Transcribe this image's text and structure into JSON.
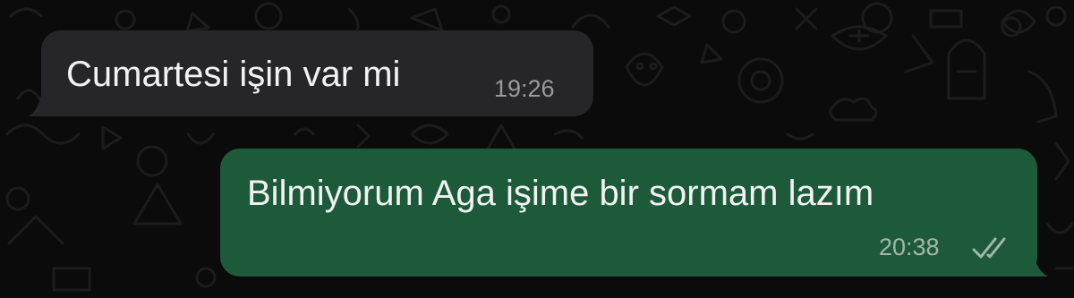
{
  "theme": {
    "background": "#0b0b0b",
    "incoming_bubble": "#262628",
    "outgoing_bubble": "#1d5a3a",
    "text": "#f2f2f2",
    "timestamp_incoming": "#9a9a9c",
    "timestamp_outgoing": "#a4b8aa"
  },
  "messages": [
    {
      "direction": "incoming",
      "text": "Cumartesi işin var mi",
      "time": "19:26"
    },
    {
      "direction": "outgoing",
      "text": "Bilmiyorum Aga işime bir sormam lazım",
      "time": "20:38",
      "status_icon": "double-check-read-icon"
    }
  ]
}
